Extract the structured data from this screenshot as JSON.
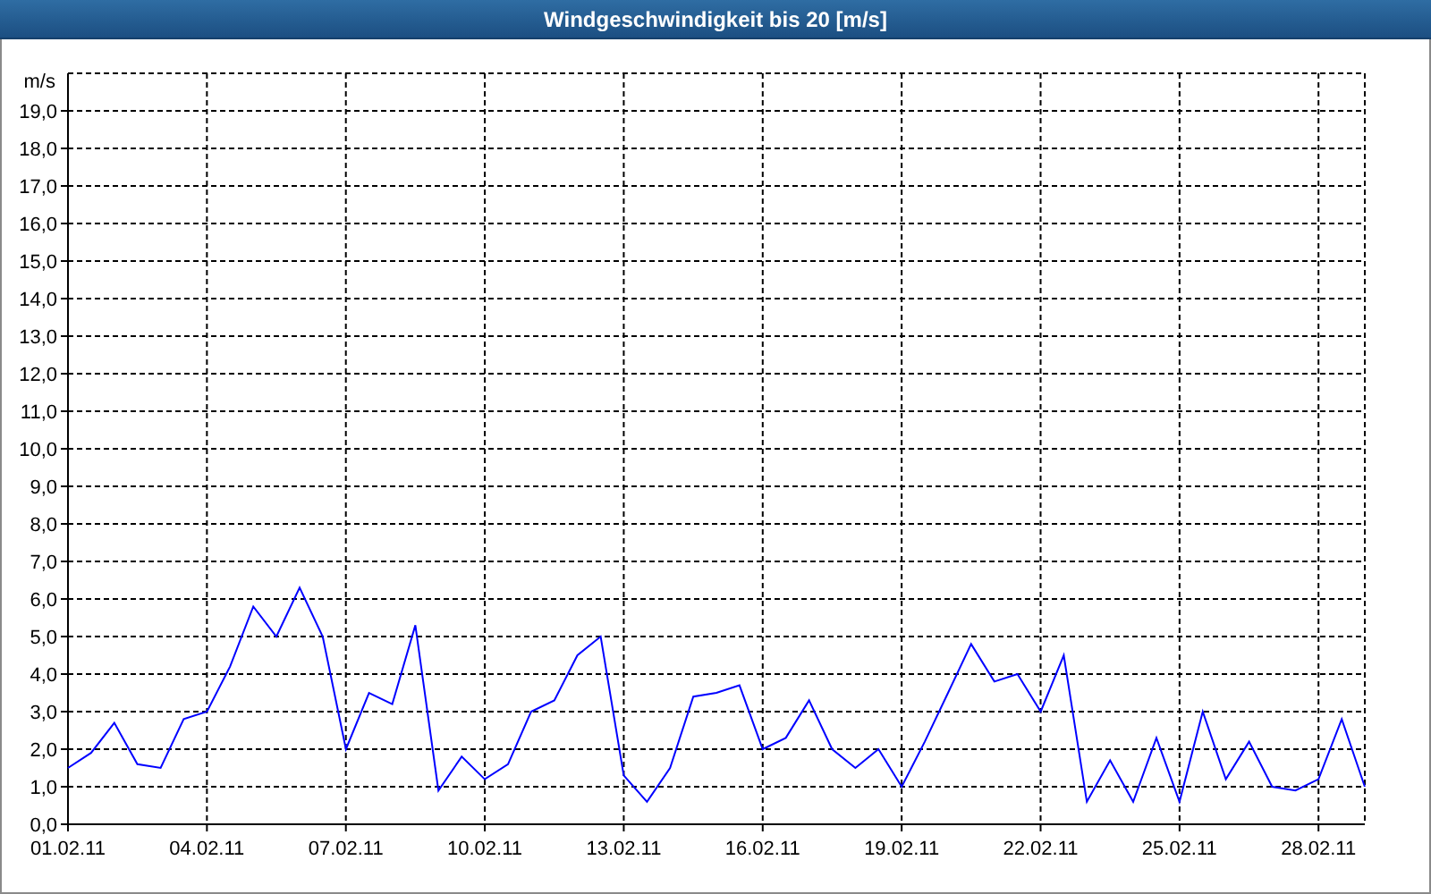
{
  "window": {
    "title": "Windgeschwindigkeit bis 20 [m/s]"
  },
  "chart": {
    "chart_data": {
      "type": "line",
      "grid": true,
      "ylabel": "m/s",
      "ylim": [
        0,
        20
      ],
      "categories": [
        "01.02.11",
        null,
        null,
        null,
        null,
        null,
        "04.02.11",
        null,
        null,
        null,
        null,
        null,
        "07.02.11",
        null,
        null,
        null,
        null,
        null,
        "10.02.11",
        null,
        null,
        null,
        null,
        null,
        "13.02.11",
        null,
        null,
        null,
        null,
        null,
        "16.02.11",
        null,
        null,
        null,
        null,
        null,
        "19.02.11",
        null,
        null,
        null,
        null,
        null,
        "22.02.11",
        null,
        null,
        null,
        null,
        null,
        "25.02.11",
        null,
        null,
        null,
        null,
        null,
        "28.02.11",
        null,
        null
      ],
      "yticks": [
        {
          "value": 0,
          "label": "0,0"
        },
        {
          "value": 1,
          "label": "1,0"
        },
        {
          "value": 2,
          "label": "2,0"
        },
        {
          "value": 3,
          "label": "3,0"
        },
        {
          "value": 4,
          "label": "4,0"
        },
        {
          "value": 5,
          "label": "5,0"
        },
        {
          "value": 6,
          "label": "6,0"
        },
        {
          "value": 7,
          "label": "7,0"
        },
        {
          "value": 8,
          "label": "8,0"
        },
        {
          "value": 9,
          "label": "9,0"
        },
        {
          "value": 10,
          "label": "10,0"
        },
        {
          "value": 11,
          "label": "11,0"
        },
        {
          "value": 12,
          "label": "12,0"
        },
        {
          "value": 13,
          "label": "13,0"
        },
        {
          "value": 14,
          "label": "14,0"
        },
        {
          "value": 15,
          "label": "15,0"
        },
        {
          "value": 16,
          "label": "16,0"
        },
        {
          "value": 17,
          "label": "17,0"
        },
        {
          "value": 18,
          "label": "18,0"
        },
        {
          "value": 19,
          "label": "19,0"
        }
      ],
      "series": [
        {
          "color": "#0000ff",
          "values": [
            1.5,
            1.9,
            2.7,
            1.6,
            1.5,
            2.8,
            3.0,
            4.2,
            5.8,
            5.0,
            6.3,
            5.0,
            2.0,
            3.5,
            3.2,
            5.3,
            0.9,
            1.8,
            1.2,
            1.6,
            3.0,
            3.3,
            4.5,
            5.0,
            1.3,
            0.6,
            1.5,
            3.4,
            3.5,
            3.7,
            2.0,
            2.3,
            3.3,
            2.0,
            1.5,
            2.0,
            1.0,
            2.2,
            3.5,
            4.8,
            3.8,
            4.0,
            3.0,
            4.5,
            0.6,
            1.7,
            0.6,
            2.3,
            0.6,
            3.0,
            1.2,
            2.2,
            1.0,
            0.9,
            1.2,
            2.8,
            1.0
          ]
        }
      ]
    }
  }
}
